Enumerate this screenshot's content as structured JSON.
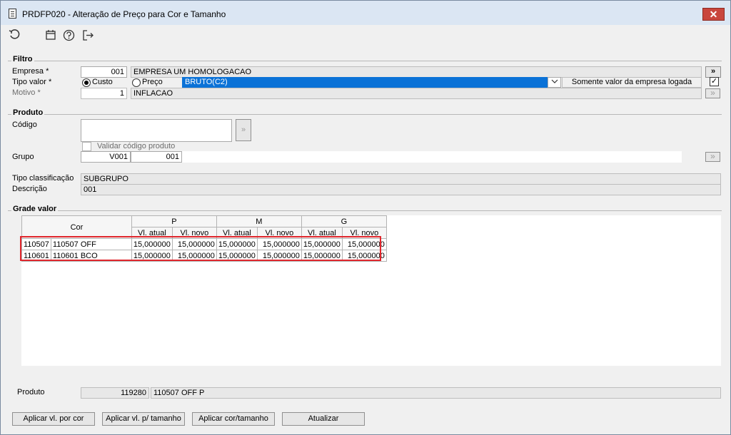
{
  "window": {
    "title": "PRDFP020 - Alteração de Preço para Cor e Tamanho",
    "close_label": "✕"
  },
  "toolbar": {
    "icons": [
      "refresh-icon",
      "calendar-icon",
      "help-icon",
      "exit-icon"
    ]
  },
  "filtro": {
    "title": "Filtro",
    "empresa_label": "Empresa *",
    "empresa_code": "001",
    "empresa_name": "EMPRESA UM HOMOLOGACAO",
    "empresa_btn": "»",
    "tipo_valor_label": "Tipo valor *",
    "custo_label": "Custo",
    "preco_label": "Preço",
    "preco_selected": "BRUTO(C2)",
    "somente_label": "Somente valor da empresa logada",
    "somente_checked": "✓",
    "motivo_label": "Motivo *",
    "motivo_code": "1",
    "motivo_name": "INFLACAO",
    "motivo_btn": "»"
  },
  "produto": {
    "title": "Produto",
    "codigo_label": "Código",
    "codigo_btn": "»",
    "validar_label": "Validar código produto",
    "grupo_label": "Grupo",
    "grupo_code1": "V001",
    "grupo_code2": "001",
    "grupo_btn": "»",
    "tipo_class_label": "Tipo classificação",
    "tipo_class_value": "SUBGRUPO",
    "descricao_label": "Descrição",
    "descricao_value": "001"
  },
  "grade": {
    "title": "Grade valor",
    "cor_header": "Cor",
    "sizes": [
      "P",
      "M",
      "G"
    ],
    "sub_atual": "Vl. atual",
    "sub_novo": "Vl. novo",
    "rows": [
      {
        "id": "110507",
        "cor": "110507 OFF",
        "values": [
          "15,000000",
          "15,000000",
          "15,000000",
          "15,000000",
          "15,000000",
          "15,000000"
        ]
      },
      {
        "id": "110601",
        "cor": "110601 BCO",
        "values": [
          "15,000000",
          "15,000000",
          "15,000000",
          "15,000000",
          "15,000000",
          "15,000000"
        ]
      }
    ]
  },
  "footer": {
    "produto_label": "Produto",
    "produto_code": "119280",
    "produto_desc": "110507 OFF P",
    "buttons": {
      "aplicar_cor": "Aplicar vl. por cor",
      "aplicar_tamanho": "Aplicar vl. p/ tamanho",
      "aplicar_cor_tamanho": "Aplicar cor/tamanho",
      "atualizar": "Atualizar"
    }
  }
}
